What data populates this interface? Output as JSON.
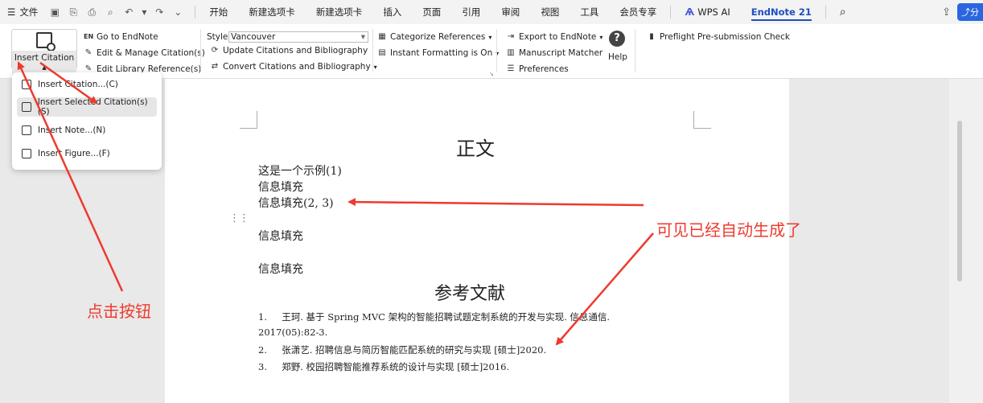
{
  "menubar": {
    "file_label": "文件",
    "tabs": [
      "开始",
      "新建选项卡",
      "新建选项卡",
      "插入",
      "页面",
      "引用",
      "审阅",
      "视图",
      "工具",
      "会员专享"
    ],
    "wps_ai": "WPS AI",
    "active_tab": "EndNote 21",
    "share": "分"
  },
  "ribbon": {
    "insert_citation": "Insert Citation",
    "go_to_endnote": "Go to EndNote",
    "edit_manage": "Edit & Manage Citation(s)",
    "edit_library": "Edit Library Reference(s)",
    "style_label": "Style:",
    "style_value": "Vancouver",
    "update": "Update Citations and Bibliography",
    "convert": "Convert Citations and Bibliography",
    "categorize": "Categorize References",
    "instant": "Instant Formatting is On",
    "export": "Export to EndNote",
    "matcher": "Manuscript Matcher",
    "preferences": "Preferences",
    "help": "Help",
    "preflight": "Preflight Pre-submission Check"
  },
  "dropdown": {
    "items": [
      "Insert Citation...(C)",
      "Insert Selected Citation(s)(S)",
      "Insert Note...(N)",
      "Insert Figure...(F)"
    ]
  },
  "document": {
    "heading1": "正文",
    "line1": "这是一个示例(1)",
    "line2": "信息填充",
    "line3": "信息填充(2, 3)",
    "line4": "信息填充",
    "line5": "信息填充",
    "heading2": "参考文献",
    "ref1a": "1.     王珂. 基于 Spring MVC 架构的智能招聘试题定制系统的开发与实现. 信息通信.",
    "ref1b": "2017(05):82-3.",
    "ref2": "2.     张潇艺. 招聘信息与简历智能匹配系统的研究与实现 [硕士]2020.",
    "ref3": "3.     郑野. 校园招聘智能推荐系统的设计与实现 [硕士]2016."
  },
  "annotations": {
    "click_button": "点击按钮",
    "auto_generated": "可见已经自动生成了",
    "color": "#ee3a2e"
  }
}
